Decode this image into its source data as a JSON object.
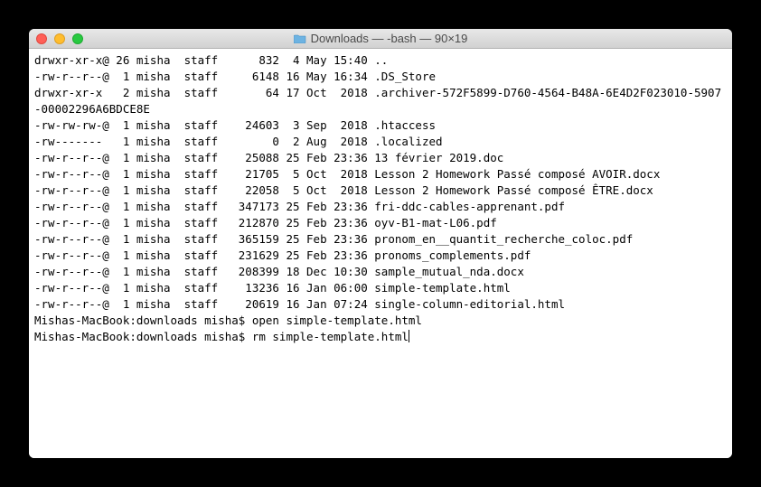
{
  "window": {
    "title": "Downloads — -bash — 90×19",
    "folder_icon": "folder-icon"
  },
  "listing": [
    {
      "perm": "drwxr-xr-x@",
      "links": "26",
      "owner": "misha",
      "group": "staff",
      "size": "832",
      "date": " 4 May 15:40",
      "name": ".."
    },
    {
      "perm": "-rw-r--r--@",
      "links": " 1",
      "owner": "misha",
      "group": "staff",
      "size": "6148",
      "date": "16 May 16:34",
      "name": ".DS_Store"
    },
    {
      "perm": "drwxr-xr-x ",
      "links": " 2",
      "owner": "misha",
      "group": "staff",
      "size": "64",
      "date": "17 Oct  2018",
      "name": ".archiver-572F5899-D760-4564-B48A-6E4D2F023010-5907-00002296A6BDCE8E"
    },
    {
      "perm": "-rw-rw-rw-@",
      "links": " 1",
      "owner": "misha",
      "group": "staff",
      "size": "24603",
      "date": " 3 Sep  2018",
      "name": ".htaccess"
    },
    {
      "perm": "-rw------- ",
      "links": " 1",
      "owner": "misha",
      "group": "staff",
      "size": "0",
      "date": " 2 Aug  2018",
      "name": ".localized"
    },
    {
      "perm": "-rw-r--r--@",
      "links": " 1",
      "owner": "misha",
      "group": "staff",
      "size": "25088",
      "date": "25 Feb 23:36",
      "name": "13 février 2019.doc"
    },
    {
      "perm": "-rw-r--r--@",
      "links": " 1",
      "owner": "misha",
      "group": "staff",
      "size": "21705",
      "date": " 5 Oct  2018",
      "name": "Lesson 2 Homework Passé composé AVOIR.docx"
    },
    {
      "perm": "-rw-r--r--@",
      "links": " 1",
      "owner": "misha",
      "group": "staff",
      "size": "22058",
      "date": " 5 Oct  2018",
      "name": "Lesson 2 Homework Passé composé ÊTRE.docx"
    },
    {
      "perm": "-rw-r--r--@",
      "links": " 1",
      "owner": "misha",
      "group": "staff",
      "size": "347173",
      "date": "25 Feb 23:36",
      "name": "fri-ddc-cables-apprenant.pdf"
    },
    {
      "perm": "-rw-r--r--@",
      "links": " 1",
      "owner": "misha",
      "group": "staff",
      "size": "212870",
      "date": "25 Feb 23:36",
      "name": "oyv-B1-mat-L06.pdf"
    },
    {
      "perm": "-rw-r--r--@",
      "links": " 1",
      "owner": "misha",
      "group": "staff",
      "size": "365159",
      "date": "25 Feb 23:36",
      "name": "pronom_en__quantit_recherche_coloc.pdf"
    },
    {
      "perm": "-rw-r--r--@",
      "links": " 1",
      "owner": "misha",
      "group": "staff",
      "size": "231629",
      "date": "25 Feb 23:36",
      "name": "pronoms_complements.pdf"
    },
    {
      "perm": "-rw-r--r--@",
      "links": " 1",
      "owner": "misha",
      "group": "staff",
      "size": "208399",
      "date": "18 Dec 10:30",
      "name": "sample_mutual_nda.docx"
    },
    {
      "perm": "-rw-r--r--@",
      "links": " 1",
      "owner": "misha",
      "group": "staff",
      "size": "13236",
      "date": "16 Jan 06:00",
      "name": "simple-template.html"
    },
    {
      "perm": "-rw-r--r--@",
      "links": " 1",
      "owner": "misha",
      "group": "staff",
      "size": "20619",
      "date": "16 Jan 07:24",
      "name": "single-column-editorial.html"
    }
  ],
  "prompts": [
    {
      "prompt": "Mishas-MacBook:downloads misha$ ",
      "command": "open simple-template.html"
    },
    {
      "prompt": "Mishas-MacBook:downloads misha$ ",
      "command": "rm simple-template.html"
    }
  ],
  "format": {
    "size_width": 7
  }
}
